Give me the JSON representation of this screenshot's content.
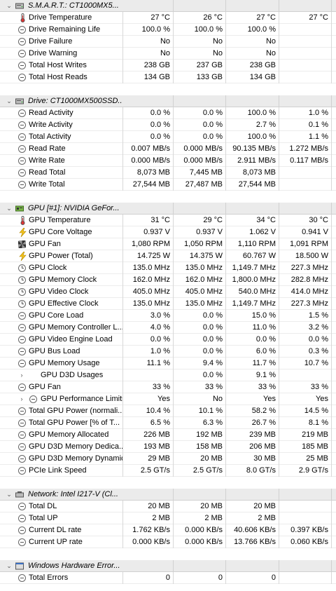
{
  "groups": [
    {
      "title": "S.M.A.R.T.: CT1000MX5...",
      "icon": "drive-icon",
      "rows": [
        {
          "label": "Drive Temperature",
          "icon": "thermometer-icon",
          "v": [
            "27 °C",
            "26 °C",
            "27 °C",
            "27 °C"
          ]
        },
        {
          "label": "Drive Remaining Life",
          "icon": "gauge-icon",
          "v": [
            "100.0 %",
            "100.0 %",
            "100.0 %",
            ""
          ]
        },
        {
          "label": "Drive Failure",
          "icon": "gauge-icon",
          "v": [
            "No",
            "No",
            "No",
            ""
          ]
        },
        {
          "label": "Drive Warning",
          "icon": "gauge-icon",
          "v": [
            "No",
            "No",
            "No",
            ""
          ]
        },
        {
          "label": "Total Host Writes",
          "icon": "gauge-icon",
          "v": [
            "238 GB",
            "237 GB",
            "238 GB",
            ""
          ]
        },
        {
          "label": "Total Host Reads",
          "icon": "gauge-icon",
          "v": [
            "134 GB",
            "133 GB",
            "134 GB",
            ""
          ]
        }
      ]
    },
    {
      "title": "Drive: CT1000MX500SSD...",
      "icon": "drive-icon",
      "rows": [
        {
          "label": "Read Activity",
          "icon": "gauge-icon",
          "v": [
            "0.0 %",
            "0.0 %",
            "100.0 %",
            "1.0 %"
          ]
        },
        {
          "label": "Write Activity",
          "icon": "gauge-icon",
          "v": [
            "0.0 %",
            "0.0 %",
            "2.7 %",
            "0.1 %"
          ]
        },
        {
          "label": "Total Activity",
          "icon": "gauge-icon",
          "v": [
            "0.0 %",
            "0.0 %",
            "100.0 %",
            "1.1 %"
          ]
        },
        {
          "label": "Read Rate",
          "icon": "gauge-icon",
          "v": [
            "0.007 MB/s",
            "0.000 MB/s",
            "90.135 MB/s",
            "1.272 MB/s"
          ]
        },
        {
          "label": "Write Rate",
          "icon": "gauge-icon",
          "v": [
            "0.000 MB/s",
            "0.000 MB/s",
            "2.911 MB/s",
            "0.117 MB/s"
          ]
        },
        {
          "label": "Read Total",
          "icon": "gauge-icon",
          "v": [
            "8,073 MB",
            "7,445 MB",
            "8,073 MB",
            ""
          ]
        },
        {
          "label": "Write Total",
          "icon": "gauge-icon",
          "v": [
            "27,544 MB",
            "27,487 MB",
            "27,544 MB",
            ""
          ]
        }
      ]
    },
    {
      "title": "GPU [#1]: NVIDIA GeFor...",
      "icon": "gpu-icon",
      "rows": [
        {
          "label": "GPU Temperature",
          "icon": "thermometer-icon",
          "v": [
            "31 °C",
            "29 °C",
            "34 °C",
            "30 °C"
          ]
        },
        {
          "label": "GPU Core Voltage",
          "icon": "lightning-icon",
          "v": [
            "0.937 V",
            "0.937 V",
            "1.062 V",
            "0.941 V"
          ]
        },
        {
          "label": "GPU Fan",
          "icon": "fan-icon",
          "v": [
            "1,080 RPM",
            "1,050 RPM",
            "1,110 RPM",
            "1,091 RPM"
          ]
        },
        {
          "label": "GPU Power (Total)",
          "icon": "lightning-icon",
          "v": [
            "14.725 W",
            "14.375 W",
            "60.767 W",
            "18.500 W"
          ]
        },
        {
          "label": "GPU Clock",
          "icon": "clock-icon",
          "v": [
            "135.0 MHz",
            "135.0 MHz",
            "1,149.7 MHz",
            "227.3 MHz"
          ]
        },
        {
          "label": "GPU Memory Clock",
          "icon": "clock-icon",
          "v": [
            "162.0 MHz",
            "162.0 MHz",
            "1,800.0 MHz",
            "282.8 MHz"
          ]
        },
        {
          "label": "GPU Video Clock",
          "icon": "clock-icon",
          "v": [
            "405.0 MHz",
            "405.0 MHz",
            "540.0 MHz",
            "414.0 MHz"
          ]
        },
        {
          "label": "GPU Effective Clock",
          "icon": "clock-icon",
          "v": [
            "135.0 MHz",
            "135.0 MHz",
            "1,149.7 MHz",
            "227.3 MHz"
          ]
        },
        {
          "label": "GPU Core Load",
          "icon": "gauge-icon",
          "v": [
            "3.0 %",
            "0.0 %",
            "15.0 %",
            "1.5 %"
          ]
        },
        {
          "label": "GPU Memory Controller L...",
          "icon": "gauge-icon",
          "v": [
            "4.0 %",
            "0.0 %",
            "11.0 %",
            "3.2 %"
          ]
        },
        {
          "label": "GPU Video Engine Load",
          "icon": "gauge-icon",
          "v": [
            "0.0 %",
            "0.0 %",
            "0.0 %",
            "0.0 %"
          ]
        },
        {
          "label": "GPU Bus Load",
          "icon": "gauge-icon",
          "v": [
            "1.0 %",
            "0.0 %",
            "6.0 %",
            "0.3 %"
          ]
        },
        {
          "label": "GPU Memory Usage",
          "icon": "gauge-icon",
          "v": [
            "11.1 %",
            "9.4 %",
            "11.7 %",
            "10.7 %"
          ]
        },
        {
          "label": "GPU D3D Usages",
          "icon": "",
          "sub": true,
          "chev": "›",
          "v": [
            "",
            "0.0 %",
            "9.1 %",
            ""
          ]
        },
        {
          "label": "GPU Fan",
          "icon": "gauge-icon",
          "v": [
            "33 %",
            "33 %",
            "33 %",
            "33 %"
          ]
        },
        {
          "label": "GPU Performance Limits",
          "icon": "gauge-icon",
          "sub": true,
          "chev": "›",
          "v": [
            "Yes",
            "No",
            "Yes",
            "Yes"
          ]
        },
        {
          "label": "Total GPU Power (normali...",
          "icon": "gauge-icon",
          "v": [
            "10.4 %",
            "10.1 %",
            "58.2 %",
            "14.5 %"
          ]
        },
        {
          "label": "Total GPU Power [% of T...",
          "icon": "gauge-icon",
          "v": [
            "6.5 %",
            "6.3 %",
            "26.7 %",
            "8.1 %"
          ]
        },
        {
          "label": "GPU Memory Allocated",
          "icon": "gauge-icon",
          "v": [
            "226 MB",
            "192 MB",
            "239 MB",
            "219 MB"
          ]
        },
        {
          "label": "GPU D3D Memory Dedica...",
          "icon": "gauge-icon",
          "v": [
            "193 MB",
            "158 MB",
            "206 MB",
            "185 MB"
          ]
        },
        {
          "label": "GPU D3D Memory Dynamic",
          "icon": "gauge-icon",
          "v": [
            "29 MB",
            "20 MB",
            "30 MB",
            "25 MB"
          ]
        },
        {
          "label": "PCIe Link Speed",
          "icon": "gauge-icon",
          "v": [
            "2.5 GT/s",
            "2.5 GT/s",
            "8.0 GT/s",
            "2.9 GT/s"
          ]
        }
      ]
    },
    {
      "title": "Network: Intel I217-V (Cl...",
      "icon": "network-icon",
      "rows": [
        {
          "label": "Total DL",
          "icon": "gauge-icon",
          "v": [
            "20 MB",
            "20 MB",
            "20 MB",
            ""
          ]
        },
        {
          "label": "Total UP",
          "icon": "gauge-icon",
          "v": [
            "2 MB",
            "2 MB",
            "2 MB",
            ""
          ]
        },
        {
          "label": "Current DL rate",
          "icon": "gauge-icon",
          "v": [
            "1.762 KB/s",
            "0.000 KB/s",
            "40.606 KB/s",
            "0.397 KB/s"
          ]
        },
        {
          "label": "Current UP rate",
          "icon": "gauge-icon",
          "v": [
            "0.000 KB/s",
            "0.000 KB/s",
            "13.766 KB/s",
            "0.060 KB/s"
          ]
        }
      ]
    },
    {
      "title": "Windows Hardware Error...",
      "icon": "error-icon",
      "rows": [
        {
          "label": "Total Errors",
          "icon": "gauge-icon",
          "v": [
            "0",
            "0",
            "0",
            ""
          ]
        }
      ]
    }
  ],
  "group_chevron": "⌄"
}
